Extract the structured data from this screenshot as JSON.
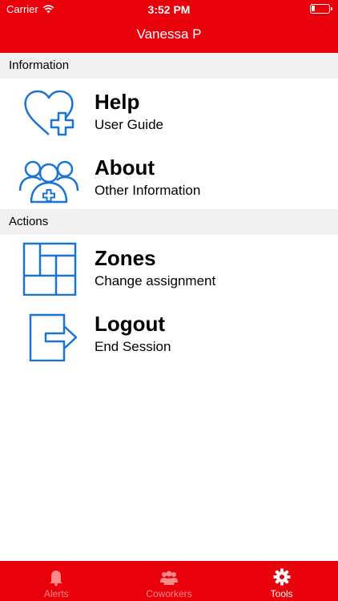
{
  "status_bar": {
    "carrier": "Carrier",
    "time": "3:52 PM"
  },
  "header": {
    "title": "Vanessa P"
  },
  "sections": [
    {
      "title": "Information",
      "items": [
        {
          "label": "Help",
          "sublabel": "User Guide",
          "icon": "heart-plus-icon"
        },
        {
          "label": "About",
          "sublabel": "Other Information",
          "icon": "people-icon"
        }
      ]
    },
    {
      "title": "Actions",
      "items": [
        {
          "label": "Zones",
          "sublabel": "Change assignment",
          "icon": "zones-icon"
        },
        {
          "label": "Logout",
          "sublabel": "End Session",
          "icon": "logout-icon"
        }
      ]
    }
  ],
  "tabbar": {
    "tabs": [
      {
        "label": "Alerts",
        "icon": "bell-icon",
        "active": false
      },
      {
        "label": "Coworkers",
        "icon": "people-icon",
        "active": false
      },
      {
        "label": "Tools",
        "icon": "gear-icon",
        "active": true
      }
    ]
  },
  "colors": {
    "brand": "#e8000b",
    "icon_blue": "#1a73d6",
    "section_bg": "#f1f1f1"
  }
}
